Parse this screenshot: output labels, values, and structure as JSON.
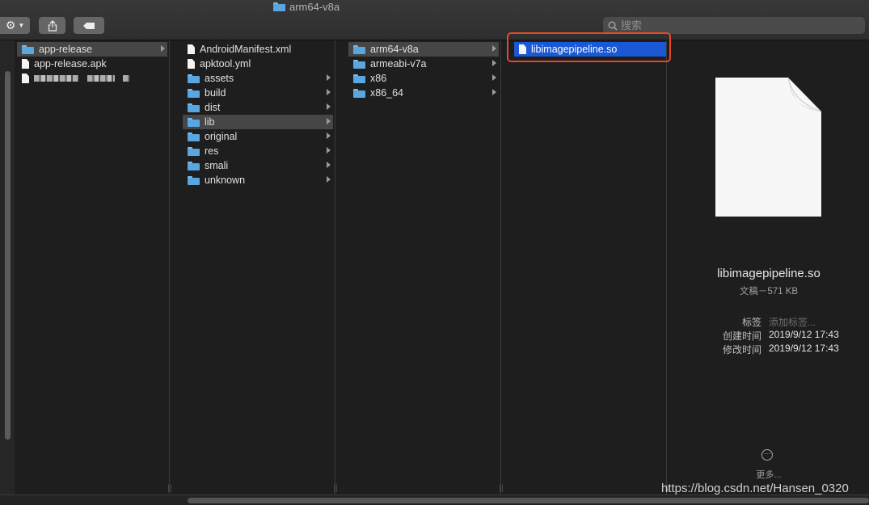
{
  "window": {
    "title": "arm64-v8a"
  },
  "toolbar": {
    "search_placeholder": "搜索"
  },
  "columns": [
    {
      "items": [
        {
          "label": "app-release",
          "type": "folder",
          "state": "selected",
          "has_children": true
        },
        {
          "label": "app-release.apk",
          "type": "file"
        },
        {
          "label": "",
          "type": "file",
          "blurred": true
        }
      ]
    },
    {
      "items": [
        {
          "label": "AndroidManifest.xml",
          "type": "file"
        },
        {
          "label": "apktool.yml",
          "type": "file"
        },
        {
          "label": "assets",
          "type": "folder",
          "has_children": true
        },
        {
          "label": "build",
          "type": "folder",
          "has_children": true
        },
        {
          "label": "dist",
          "type": "folder",
          "has_children": true
        },
        {
          "label": "lib",
          "type": "folder",
          "state": "selected",
          "has_children": true
        },
        {
          "label": "original",
          "type": "folder",
          "has_children": true
        },
        {
          "label": "res",
          "type": "folder",
          "has_children": true
        },
        {
          "label": "smali",
          "type": "folder",
          "has_children": true
        },
        {
          "label": "unknown",
          "type": "folder",
          "has_children": true
        }
      ]
    },
    {
      "items": [
        {
          "label": "arm64-v8a",
          "type": "folder",
          "state": "selected",
          "has_children": true
        },
        {
          "label": "armeabi-v7a",
          "type": "folder",
          "has_children": true
        },
        {
          "label": "x86",
          "type": "folder",
          "has_children": true
        },
        {
          "label": "x86_64",
          "type": "folder",
          "has_children": true
        }
      ]
    },
    {
      "items": [
        {
          "label": "libimagepipeline.so",
          "type": "file",
          "state": "active"
        }
      ]
    }
  ],
  "preview": {
    "name": "libimagepipeline.so",
    "kind": "文稿－571 KB",
    "tags_label": "标签",
    "tags_placeholder": "添加标签...",
    "created_label": "创建时间",
    "created_value": "2019/9/12 17:43",
    "modified_label": "修改时间",
    "modified_value": "2019/9/12 17:43",
    "more_label": "更多..."
  },
  "watermark": "https://blog.csdn.net/Hansen_0320",
  "colors": {
    "selection_active": "#1b58d6",
    "highlight_box": "#e3492a",
    "folder": "#5aa6e1"
  }
}
